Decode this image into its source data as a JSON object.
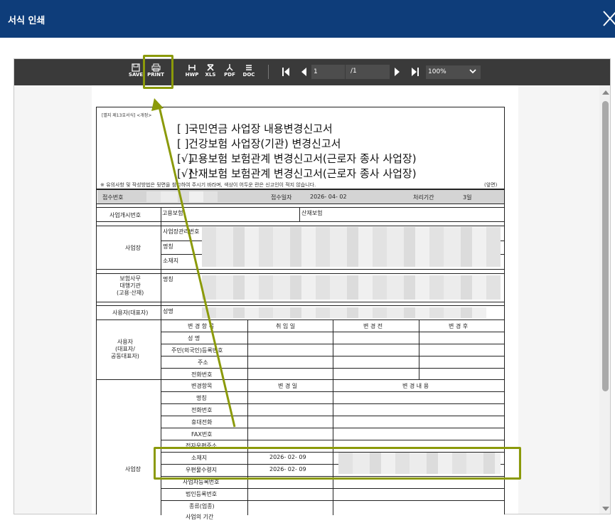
{
  "dialog": {
    "title": "서식 인쇄"
  },
  "toolbar": {
    "save": "SAVE",
    "print": "PRINT",
    "hwp": "HWP",
    "xls": "XLS",
    "pdf": "PDF",
    "doc": "DOC",
    "page_current": "1",
    "page_total": "/1",
    "zoom": "100%"
  },
  "form": {
    "form_id": "[별지 제13호서식] <개정>",
    "titles": [
      {
        "box": "[   ]",
        "text": "국민연금 사업장 내용변경신고서"
      },
      {
        "box": "[   ]",
        "text": "건강보험 사업장(기관) 변경신고서"
      },
      {
        "box": "[√]",
        "text": "고용보험 보험관계 변경신고서(근로자 종사 사업장)"
      },
      {
        "box": "[√]",
        "text": "산재보험 보험관계 변경신고서(근로자 종사 사업장)"
      }
    ],
    "note": "※ 유의사항 및 작성방법은 뒷면을 참고하여 주시기 바라며, 색상이 어두운 란은 신고인이 적지 않습니다.",
    "page_side": "(앞면)",
    "receipt_no": "접수번호",
    "receipt_date_label": "접수일자",
    "receipt_date": "2026- 04- 02",
    "process_period_label": "처리기간",
    "process_period": "3일",
    "start_no_label": "사업개시번호",
    "emp_ins": "고용보험",
    "ind_ins": "산재보험",
    "biz_label": "사업장",
    "biz_mgmt_no": "사업장관리번호",
    "name_label": "명칭",
    "address_label": "소재지",
    "agent_label": "보험사무\n대행기관\n(고용·산재)",
    "agent_name": "명칭",
    "employer_label": "사용자(대표자)",
    "employer_name": "성명",
    "user_section_label": "사용자\n(대표자/\n공동대표자)",
    "user_headers": [
      "변 경 항 목",
      "취 임 일",
      "변 경 전",
      "변 경 후"
    ],
    "user_rows": [
      "성      명",
      "주민(외국인)등록번호",
      "주소",
      "전화번호"
    ],
    "biz_headers": [
      "변경항목",
      "변 경 일",
      "변 경 내 용"
    ],
    "biz_rows": [
      {
        "item": "명칭",
        "date": ""
      },
      {
        "item": "전화번호",
        "date": ""
      },
      {
        "item": "휴대전화",
        "date": ""
      },
      {
        "item": "FAX번호",
        "date": ""
      },
      {
        "item": "전자우편주소",
        "date": ""
      },
      {
        "item": "소재지",
        "date": "2026- 02- 09"
      },
      {
        "item": "우편물수령지",
        "date": "2026- 02- 09"
      },
      {
        "item": "사업자등록번호",
        "date": ""
      },
      {
        "item": "법인등록번호",
        "date": ""
      },
      {
        "item": "종류(업종)",
        "date": ""
      },
      {
        "item": "사업의 기간",
        "date": ""
      }
    ],
    "biz_section_label": "사업장"
  },
  "colors": {
    "titlebar": "#0e3d7a",
    "toolbar": "#3a3a3a",
    "highlight": "#8b9a0a"
  }
}
